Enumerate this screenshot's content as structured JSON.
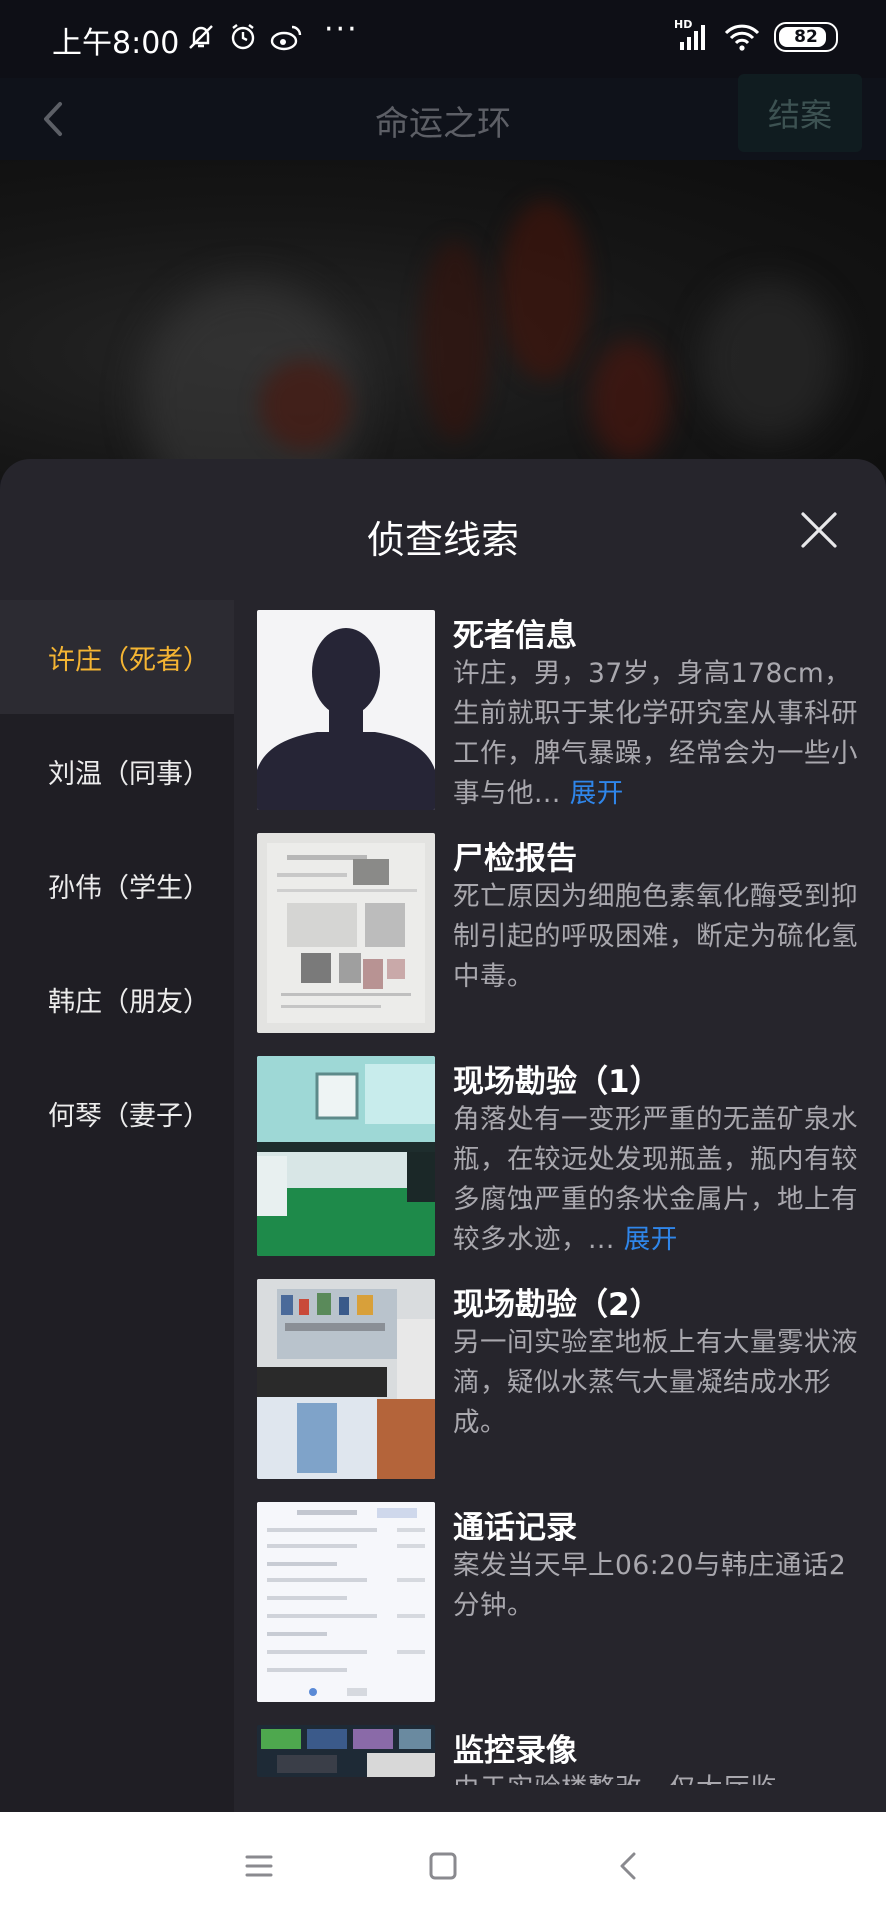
{
  "status_bar": {
    "time": "上午8:00",
    "more": "···",
    "network": "HD",
    "battery": "82",
    "icons": [
      "bell-off-icon",
      "alarm-icon",
      "weibo-icon",
      "signal-icon",
      "wifi-icon",
      "battery-icon"
    ]
  },
  "nav": {
    "title": "命运之环",
    "close_case": "结案",
    "back_icon": "chevron-left-icon"
  },
  "sheet": {
    "title": "侦查线索",
    "close_icon": "close-icon"
  },
  "suspects": [
    {
      "label": "许庄（死者）",
      "active": true
    },
    {
      "label": "刘温（同事）",
      "active": false
    },
    {
      "label": "孙伟（学生）",
      "active": false
    },
    {
      "label": "韩庄（朋友）",
      "active": false
    },
    {
      "label": "何琴（妻子）",
      "active": false
    }
  ],
  "clues": [
    {
      "title": "死者信息",
      "text": "许庄，男，37岁，身高178cm，生前就职于某化学研究室从事科研工作，脾气暴躁，经常会为一些小事与他...",
      "expand": "展开"
    },
    {
      "title": "尸检报告",
      "text": "死亡原因为细胞色素氧化酶受到抑制引起的呼吸困难，断定为硫化氢中毒。",
      "expand": ""
    },
    {
      "title": "现场勘验（1）",
      "text": "角落处有一变形严重的无盖矿泉水瓶，在较远处发现瓶盖，瓶内有较多腐蚀严重的条状金属片，地上有较多水迹，...",
      "expand": "展开"
    },
    {
      "title": "现场勘验（2）",
      "text": "另一间实验室地板上有大量雾状液滴，疑似水蒸气大量凝结成水形成。",
      "expand": ""
    },
    {
      "title": "通话记录",
      "text": "案发当天早上06:20与韩庄通话2分钟。",
      "expand": ""
    },
    {
      "title": "监控录像",
      "text": "由于实验楼整改，仅大厅监",
      "expand": ""
    }
  ],
  "colors": {
    "active_suspect": "#f5b533",
    "expand_link": "#2f86ea",
    "sheet_bg": "#26252c",
    "sidebar_bg": "#1f1e24"
  },
  "navbar": {
    "icons": [
      "menu-icon",
      "home-square-icon",
      "back-triangle-icon"
    ]
  }
}
